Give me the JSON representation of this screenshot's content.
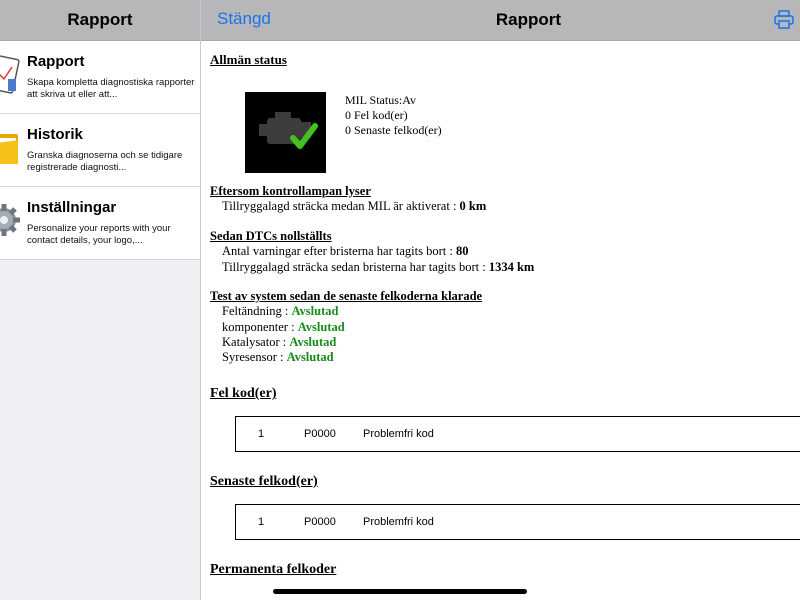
{
  "sidebar": {
    "title": "Rapport",
    "items": [
      {
        "title": "Rapport",
        "desc": "Skapa kompletta diagnostiska rapporter att skriva ut eller att...",
        "icon": "report-icon"
      },
      {
        "title": "Historik",
        "desc": "Granska diagnoserna och se tidigare registrerade diagnosti...",
        "icon": "history-folder-icon"
      },
      {
        "title": "Inställningar",
        "desc": "Personalize your reports with your contact details, your logo,...",
        "icon": "gear-icon"
      }
    ]
  },
  "header": {
    "close_label": "Stängd",
    "title": "Rapport"
  },
  "report": {
    "general": {
      "title": "Allmän status",
      "mil_status": "MIL Status:Av",
      "fault_count": "0 Fel kod(er)",
      "recent_count": "0 Senaste felkod(er)"
    },
    "mil_on": {
      "title": "Eftersom kontrollampan lyser",
      "distance_label": "Tillryggalagd sträcka medan MIL är aktiverat :",
      "distance_value": "0 km"
    },
    "dtc_cleared": {
      "title": "Sedan DTCs nollställts",
      "warmups_label": "Antal varningar efter bristerna har tagits bort :",
      "warmups_value": "80",
      "distance_label": "Tillryggalagd sträcka sedan bristerna har tagits bort :",
      "distance_value": "1334 km"
    },
    "tests": {
      "title": "Test av system sedan de senaste felkoderna klarade",
      "items": [
        {
          "label": "Feltändning :",
          "value": "Avslutad"
        },
        {
          "label": "komponenter :",
          "value": "Avslutad"
        },
        {
          "label": "Katalysator :",
          "value": "Avslutad"
        },
        {
          "label": "Syresensor :",
          "value": "Avslutad"
        }
      ]
    },
    "fault_codes": {
      "title": "Fel kod(er)",
      "row": {
        "num": "1",
        "code": "P0000",
        "desc": "Problemfri kod"
      }
    },
    "recent_codes": {
      "title": "Senaste felkod(er)",
      "row": {
        "num": "1",
        "code": "P0000",
        "desc": "Problemfri kod"
      }
    },
    "permanent": {
      "title": "Permanenta felkoder"
    }
  },
  "colors": {
    "accent": "#1a73e8",
    "status_green": "#1a8a1a",
    "header_gray": "#b7b7b9"
  }
}
